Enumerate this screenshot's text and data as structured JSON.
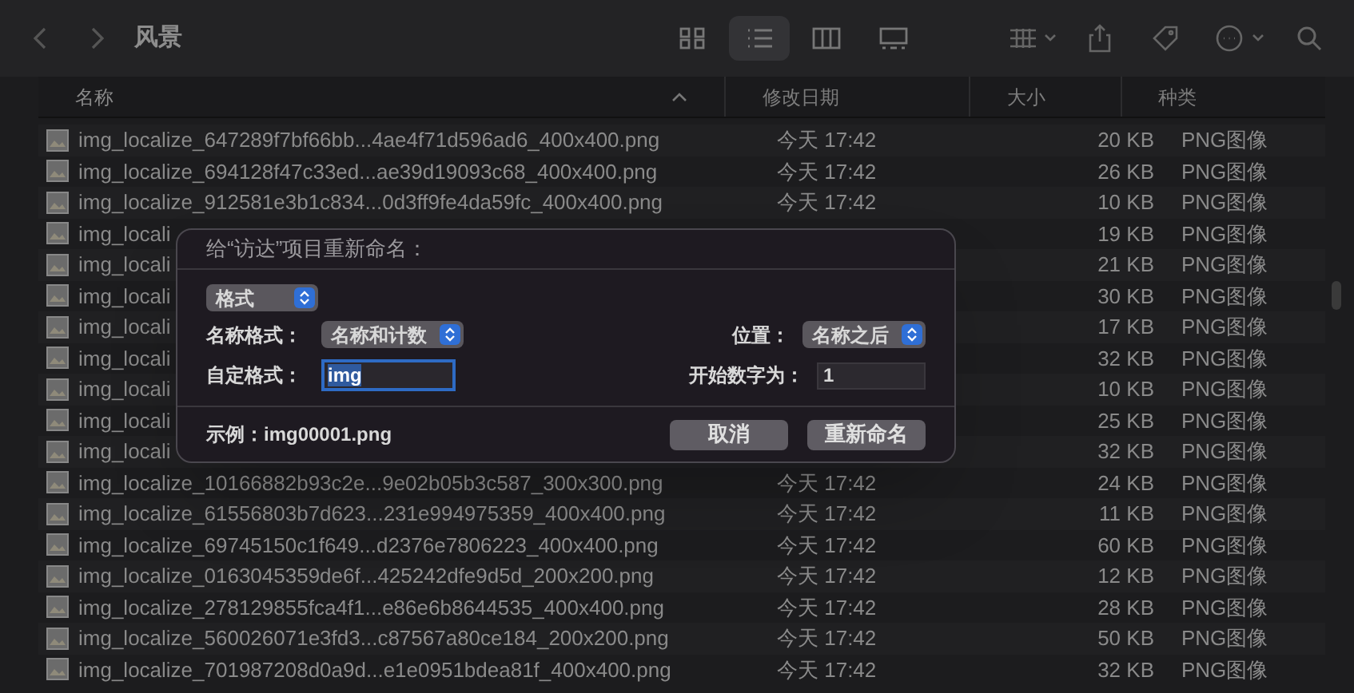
{
  "toolbar": {
    "title": "风景",
    "view_buttons": [
      {
        "kind": "icons",
        "selected": false
      },
      {
        "kind": "list",
        "selected": true
      },
      {
        "kind": "columns",
        "selected": false
      },
      {
        "kind": "gallery",
        "selected": false
      }
    ]
  },
  "columns": [
    {
      "label": "名称",
      "sorted": true
    },
    {
      "label": "修改日期",
      "sorted": false
    },
    {
      "label": "大小",
      "sorted": false
    },
    {
      "label": "种类",
      "sorted": false
    }
  ],
  "rows": [
    {
      "name": "img_localize_647289f7bf66bb...4ae4f71d596ad6_400x400.png",
      "date": "今天 17:42",
      "size": "20 KB",
      "type": "PNG图像"
    },
    {
      "name": "img_localize_694128f47c33ed...ae39d19093c68_400x400.png",
      "date": "今天 17:42",
      "size": "26 KB",
      "type": "PNG图像"
    },
    {
      "name": "img_localize_912581e3b1c834...0d3ff9fe4da59fc_400x400.png",
      "date": "今天 17:42",
      "size": "10 KB",
      "type": "PNG图像"
    },
    {
      "name": "img_locali",
      "size": "19 KB",
      "type": "PNG图像"
    },
    {
      "name": "img_locali",
      "size": "21 KB",
      "type": "PNG图像"
    },
    {
      "name": "img_locali",
      "size": "30 KB",
      "type": "PNG图像"
    },
    {
      "name": "img_locali",
      "size": "17 KB",
      "type": "PNG图像"
    },
    {
      "name": "img_locali",
      "size": "32 KB",
      "type": "PNG图像"
    },
    {
      "name": "img_locali",
      "size": "10 KB",
      "type": "PNG图像"
    },
    {
      "name": "img_locali",
      "size": "25 KB",
      "type": "PNG图像"
    },
    {
      "name": "img_locali",
      "size": "32 KB",
      "type": "PNG图像"
    },
    {
      "name": "img_localize_10166882b93c2e...9e02b05b3c587_300x300.png",
      "date": "今天 17:42",
      "size": "24 KB",
      "type": "PNG图像"
    },
    {
      "name": "img_localize_61556803b7d623...231e994975359_400x400.png",
      "date": "今天 17:42",
      "size": "11 KB",
      "type": "PNG图像"
    },
    {
      "name": "img_localize_69745150c1f649...d2376e7806223_400x400.png",
      "date": "今天 17:42",
      "size": "60 KB",
      "type": "PNG图像"
    },
    {
      "name": "img_localize_0163045359de6f...425242dfe9d5d_200x200.png",
      "date": "今天 17:42",
      "size": "12 KB",
      "type": "PNG图像"
    },
    {
      "name": "img_localize_278129855fca4f1...e86e6b8644535_400x400.png",
      "date": "今天 17:42",
      "size": "28 KB",
      "type": "PNG图像"
    },
    {
      "name": "img_localize_560026071e3fd3...c87567a80ce184_200x200.png",
      "date": "今天 17:42",
      "size": "50 KB",
      "type": "PNG图像"
    },
    {
      "name": "img_localize_701987208d0a9d...e1e0951bdea81f_400x400.png",
      "date": "今天 17:42",
      "size": "32 KB",
      "type": "PNG图像"
    }
  ],
  "dialog": {
    "title": "给“访达”项目重新命名：",
    "mode": "格式",
    "name_format_label": "名称格式：",
    "name_format": "名称和计数",
    "position_label": "位置：",
    "position": "名称之后",
    "custom_label": "自定格式：",
    "custom_value": "img",
    "start_label": "开始数字为：",
    "start_value": "1",
    "example": "示例：img00001.png",
    "buttons": [
      {
        "label": "取消"
      },
      {
        "label": "重新命名"
      }
    ]
  }
}
